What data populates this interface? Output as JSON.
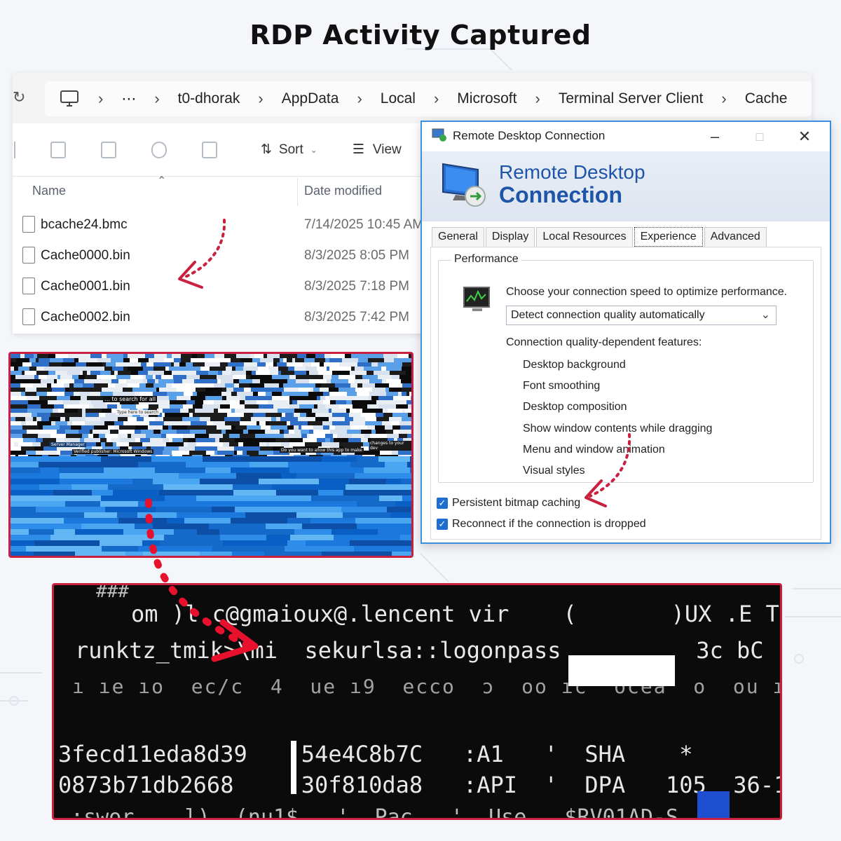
{
  "title": "RDP Activity Captured",
  "explorer": {
    "breadcrumb": [
      "⋯",
      "t0-dhorak",
      "AppData",
      "Local",
      "Microsoft",
      "Terminal Server Client",
      "Cache"
    ],
    "toolbar": {
      "sort_label": "Sort",
      "view_label": "View"
    },
    "columns": {
      "name": "Name",
      "date_modified": "Date modified"
    },
    "files": [
      {
        "name": "bcache24.bmc",
        "date": "7/14/2025 10:45 AM"
      },
      {
        "name": "Cache0000.bin",
        "date": "8/3/2025 8:05 PM"
      },
      {
        "name": "Cache0001.bin",
        "date": "8/3/2025 7:18 PM"
      },
      {
        "name": "Cache0002.bin",
        "date": "8/3/2025 7:42 PM"
      }
    ]
  },
  "cache_fragments": {
    "text_1": "… to search for all",
    "text_2": "Type here to search",
    "text_3": "Server Manager",
    "text_4": "Verified publisher: Microsoft Windows",
    "text_5": "Do you want to allow this app to make",
    "text_6": "changes to your dev"
  },
  "rdp": {
    "window_title": "Remote Desktop Connection",
    "banner_line1": "Remote Desktop",
    "banner_line2": "Connection",
    "tabs": [
      "General",
      "Display",
      "Local Resources",
      "Experience",
      "Advanced"
    ],
    "active_tab": "Experience",
    "performance": {
      "legend": "Performance",
      "prompt": "Choose your connection speed to optimize performance.",
      "selected_speed": "Detect connection quality automatically",
      "features_heading": "Connection quality-dependent features:",
      "features": [
        "Desktop background",
        "Font smoothing",
        "Desktop composition",
        "Show window contents while dragging",
        "Menu and window animation",
        "Visual styles"
      ]
    },
    "options": [
      {
        "label": "Persistent bitmap caching",
        "checked": true
      },
      {
        "label": "Reconnect if the connection is dropped",
        "checked": true
      }
    ]
  },
  "terminal": {
    "lines": [
      "###",
      "om )l.c@gmaioux@.lencent vir    (       )UX .E T",
      "runktz_tmik>\\mi  sekurlsa::logonpass          3c bC",
      "3fecd11eda8d39    54e4C8b7C   :A1   '  SHA    *",
      "0873b71db2668     30f810da8   :API  '  DPA   105  36-15701",
      ".:swor    l)  (nu1$   '  Pac   '  Use   $RV01AD-S"
    ]
  },
  "colors": {
    "highlight_border": "#c8203e",
    "rdp_accent": "#1f55a8",
    "checkbox": "#1c6fd1"
  }
}
